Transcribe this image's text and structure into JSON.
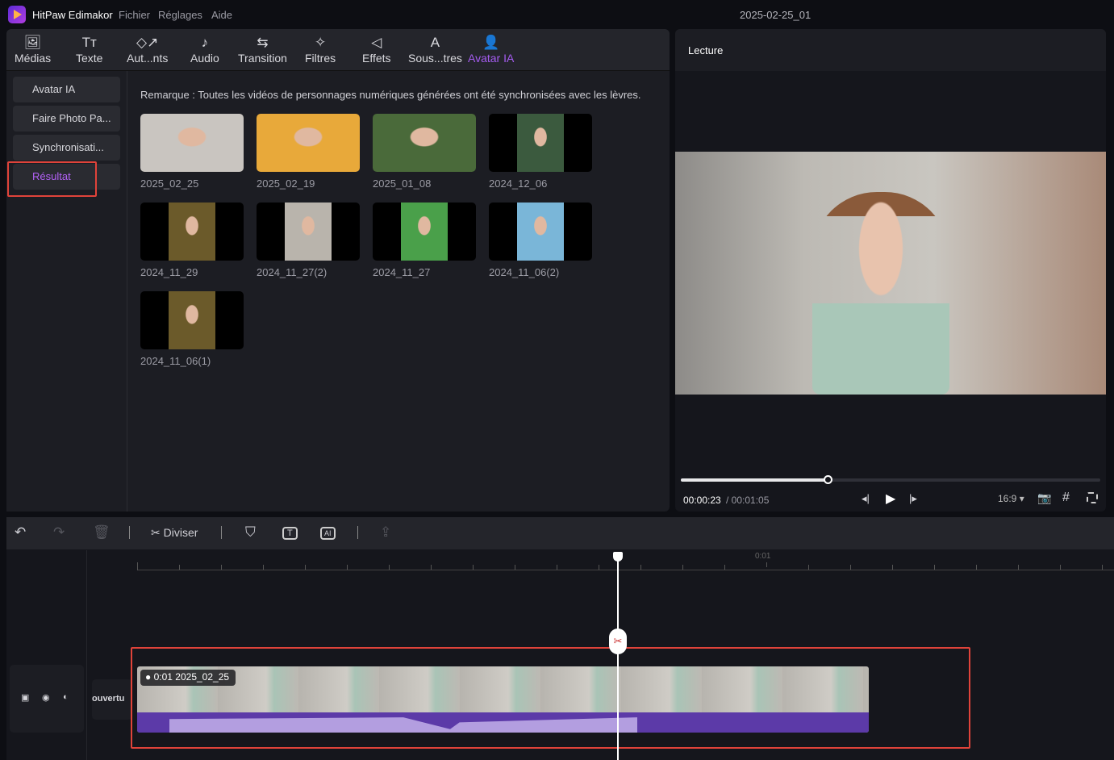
{
  "app": {
    "name": "HitPaw Edimakor",
    "menu": [
      "Fichier",
      "Réglages",
      "Aide"
    ],
    "project_title": "2025-02-25_01"
  },
  "tabs": [
    {
      "label": "Médias",
      "icon": "media-icon"
    },
    {
      "label": "Texte",
      "icon": "text-icon"
    },
    {
      "label": "Aut...nts",
      "icon": "elements-icon"
    },
    {
      "label": "Audio",
      "icon": "music-icon"
    },
    {
      "label": "Transition",
      "icon": "transition-icon"
    },
    {
      "label": "Filtres",
      "icon": "filter-icon"
    },
    {
      "label": "Effets",
      "icon": "effects-icon"
    },
    {
      "label": "Sous...tres",
      "icon": "subtitles-icon"
    },
    {
      "label": "Avatar IA",
      "icon": "avatar-icon",
      "active": true
    }
  ],
  "sidebar": {
    "items": [
      {
        "label": "Avatar IA"
      },
      {
        "label": "Faire Photo Pa..."
      },
      {
        "label": "Synchronisati..."
      },
      {
        "label": "Résultat",
        "active": true
      }
    ]
  },
  "main": {
    "note": "Remarque : Toutes les vidéos de personnages numériques générées ont été synchronisées avec les lèvres.",
    "results": [
      {
        "label": "2025_02_25"
      },
      {
        "label": "2025_02_19"
      },
      {
        "label": "2025_01_08"
      },
      {
        "label": "2024_12_06"
      },
      {
        "label": "2024_11_29"
      },
      {
        "label": "2024_11_27(2)"
      },
      {
        "label": "2024_11_27"
      },
      {
        "label": "2024_11_06(2)"
      },
      {
        "label": "2024_11_06(1)"
      }
    ]
  },
  "preview": {
    "title": "Lecture",
    "current_time": "00:00:23",
    "total_time": "/ 00:01:05",
    "progress": 0.35,
    "aspect": "16:9"
  },
  "timeline": {
    "split_label": "Diviser",
    "ruler_label": "0:01",
    "track_label": "ouvertu",
    "clip": {
      "duration": "0:01",
      "name": "2025_02_25"
    }
  },
  "colors": {
    "accent": "#a55cf0",
    "highlight": "#e0433a",
    "audio": "#5c3aa8"
  }
}
